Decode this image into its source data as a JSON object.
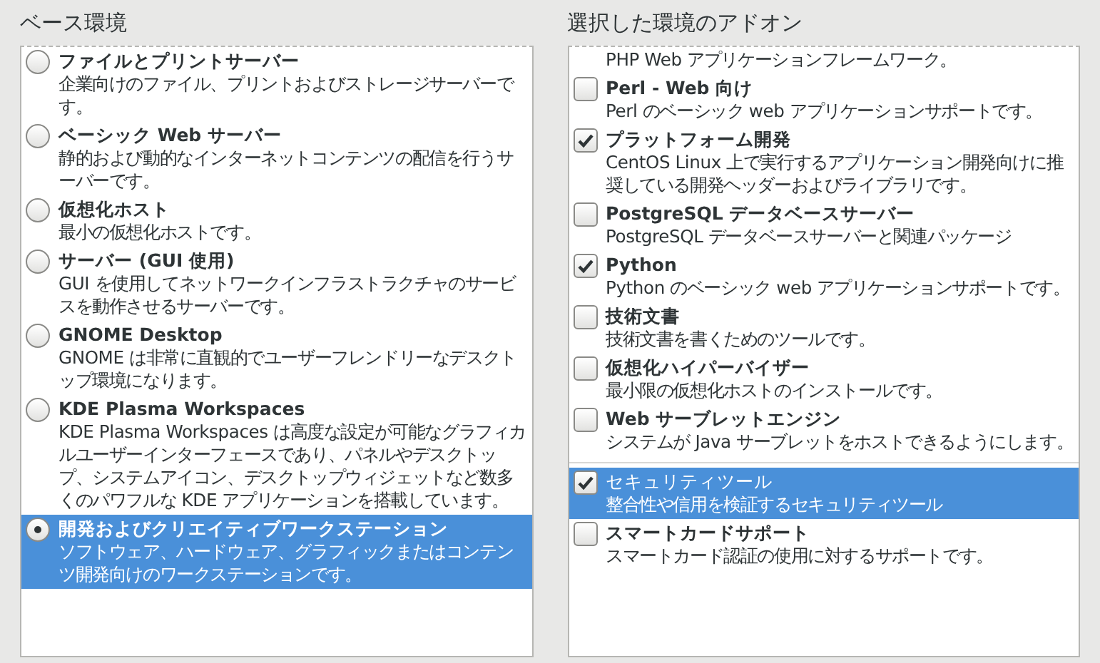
{
  "base_environment": {
    "heading": "ベース環境",
    "items": [
      {
        "title": "ファイルとプリントサーバー",
        "description": "企業向けのファイル、プリントおよびストレージサーバーです。",
        "selected": false
      },
      {
        "title": "ベーシック Web サーバー",
        "description": "静的および動的なインターネットコンテンツの配信を行うサーバーです。",
        "selected": false
      },
      {
        "title": "仮想化ホスト",
        "description": "最小の仮想化ホストです。",
        "selected": false
      },
      {
        "title": "サーバー (GUI 使用)",
        "description": "GUI を使用してネットワークインフラストラクチャのサービスを動作させるサーバーです。",
        "selected": false
      },
      {
        "title": "GNOME Desktop",
        "description": "GNOME は非常に直観的でユーザーフレンドリーなデスクトップ環境になります。",
        "selected": false
      },
      {
        "title": "KDE Plasma Workspaces",
        "description": "KDE Plasma Workspaces は高度な設定が可能なグラフィカルユーザーインターフェースであり、パネルやデスクトップ、システムアイコン、デスクトップウィジェットなど数多くのパワフルな KDE アプリケーションを搭載しています。",
        "selected": false
      },
      {
        "title": "開発およびクリエイティブワークステーション",
        "description": "ソフトウェア、ハードウェア、グラフィックまたはコンテンツ開発向けのワークステーションです。",
        "selected": true
      }
    ]
  },
  "addons": {
    "heading": "選択した環境のアドオン",
    "groups": [
      [
        {
          "description": "PHP Web アプリケーションフレームワーク。"
        },
        {
          "title": "Perl - Web 向け",
          "description": "Perl のベーシック web アプリケーションサポートです。",
          "checked": false,
          "selected": false
        },
        {
          "title": "プラットフォーム開発",
          "description": "CentOS Linux 上で実行するアプリケーション開発向けに推奨している開発ヘッダーおよびライブラリです。",
          "checked": true,
          "selected": false
        },
        {
          "title": "PostgreSQL データベースサーバー",
          "description": "PostgreSQL データベースサーバーと関連パッケージ",
          "checked": false,
          "selected": false
        },
        {
          "title": "Python",
          "description": "Python のベーシック web アプリケーションサポートです。",
          "checked": true,
          "selected": false
        },
        {
          "title": "技術文書",
          "description": "技術文書を書くためのツールです。",
          "checked": false,
          "selected": false
        },
        {
          "title": "仮想化ハイパーバイザー",
          "description": "最小限の仮想化ホストのインストールです。",
          "checked": false,
          "selected": false
        },
        {
          "title": "Web サーブレットエンジン",
          "description": "システムが Java サーブレットをホストできるようにします。",
          "checked": false,
          "selected": false
        }
      ],
      [
        {
          "title": "セキュリティツール",
          "description": "整合性や信用を検証するセキュリティツール",
          "checked": true,
          "selected": true
        },
        {
          "title": "スマートカードサポート",
          "description": "スマートカード認証の使用に対するサポートです。",
          "checked": false,
          "selected": false
        }
      ]
    ]
  }
}
